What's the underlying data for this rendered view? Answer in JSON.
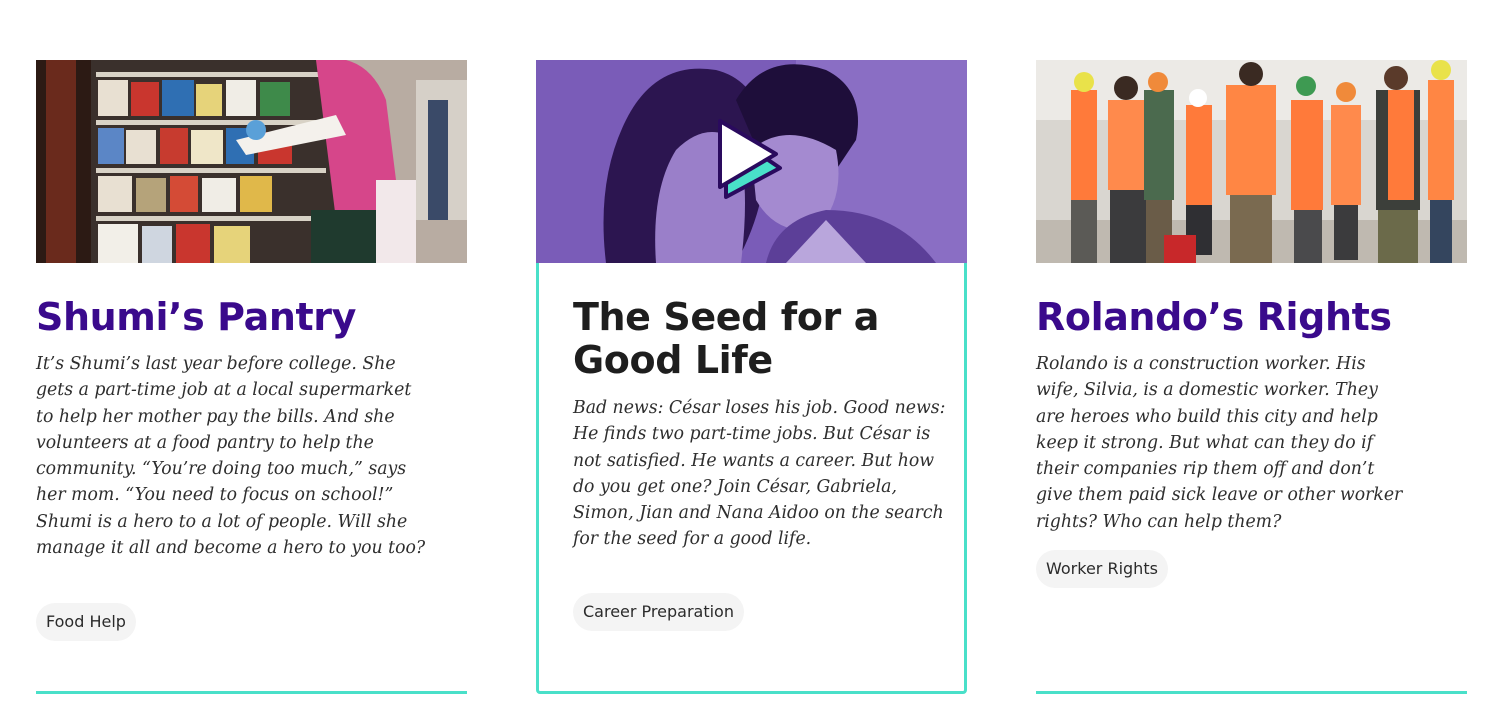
{
  "cards": [
    {
      "title": "Shumi’s Pantry",
      "description": "It’s Shumi’s last year before college. She gets a part-time job at a local supermarket to help her mother pay the bills. And she volunteers at a food pantry to help the community. “You’re doing too much,” says her mom. “You need to focus on school!” Shumi is a hero to a lot of people. Will she manage it all and become a hero to you too?",
      "tag": "Food Help"
    },
    {
      "title": "The Seed for a Good Life",
      "description": "Bad news: César loses his job. Good news: He finds two part-time jobs. But César is not satisfied. He wants a career. But how do you get one? Join César, Gabriela, Simon, Jian and Nana Aidoo on the search for the seed for a good life.",
      "tag": "Career Preparation",
      "media_icon": "play-icon"
    },
    {
      "title": "Rolando’s Rights",
      "description": "Rolando is a construction worker. His wife, Silvia, is a domestic worker. They are heroes who build this city and help keep it strong. But what can they do if their companies rip them off and don’t give them paid sick leave or other worker rights? Who can help them?",
      "tag": "Worker Rights"
    }
  ],
  "colors": {
    "accent": "#49e0c9",
    "title_purple": "#3a0a8c",
    "video_overlay": "#7a5cb8",
    "tag_bg": "#f4f4f4"
  }
}
